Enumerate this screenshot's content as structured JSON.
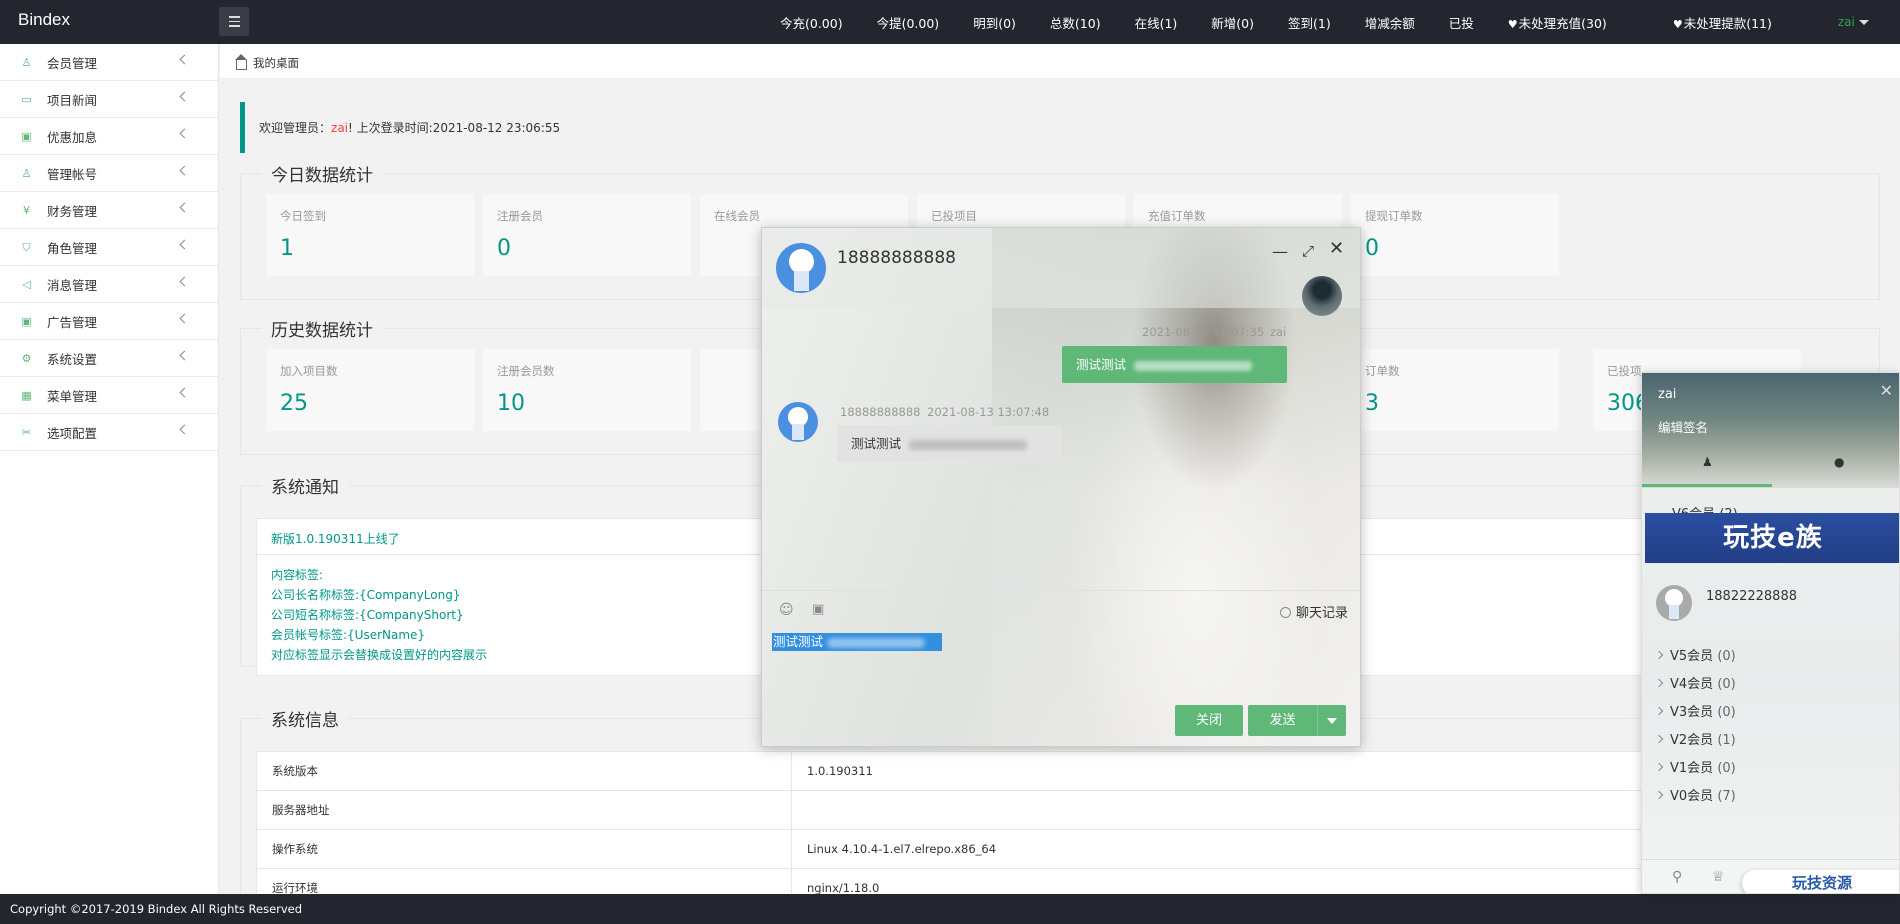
{
  "app": {
    "brand": "Bindex"
  },
  "topnav": {
    "items": [
      "今充(0.00)",
      "今提(0.00)",
      "明到(0)",
      "总数(10)",
      "在线(1)",
      "新增(0)",
      "签到(1)",
      "增减余额",
      "已投"
    ],
    "alerts": [
      "未处理充值(30)",
      "未处理提款(11)"
    ],
    "user": "zai",
    "alert_color": "#ff2b2b"
  },
  "sidebar": {
    "items": [
      {
        "label": "会员管理",
        "icon": "user-icon"
      },
      {
        "label": "项目新闻",
        "icon": "book-icon"
      },
      {
        "label": "优惠加息",
        "icon": "image-icon"
      },
      {
        "label": "管理帐号",
        "icon": "admin-icon"
      },
      {
        "label": "财务管理",
        "icon": "finance-icon"
      },
      {
        "label": "角色管理",
        "icon": "shield-icon"
      },
      {
        "label": "消息管理",
        "icon": "speaker-icon"
      },
      {
        "label": "广告管理",
        "icon": "picture-icon"
      },
      {
        "label": "系统设置",
        "icon": "gear-icon"
      },
      {
        "label": "菜单管理",
        "icon": "grid-icon"
      },
      {
        "label": "选项配置",
        "icon": "tools-icon"
      }
    ]
  },
  "breadcrumb": {
    "home": "我的桌面"
  },
  "welcome": {
    "prefix": "欢迎管理员：",
    "user": "zai",
    "suffix": "! 上次登录时间:2021-08-12 23:06:55"
  },
  "today": {
    "title": "今日数据统计",
    "cards": [
      {
        "label": "今日签到",
        "value": "1"
      },
      {
        "label": "注册会员",
        "value": "0"
      },
      {
        "label": "在线会员",
        "value": ""
      },
      {
        "label": "已投项目",
        "value": ""
      },
      {
        "label": "充值订单数",
        "value": ""
      },
      {
        "label": "提现订单数",
        "value": "0"
      }
    ]
  },
  "history": {
    "title": "历史数据统计",
    "cards": [
      {
        "label": "加入项目数",
        "value": "25"
      },
      {
        "label": "注册会员数",
        "value": "10"
      },
      {
        "label": "",
        "value": ""
      },
      {
        "label": "",
        "value": ""
      },
      {
        "label": "订单数",
        "value": "3"
      },
      {
        "label": "已投项",
        "value": "306"
      }
    ]
  },
  "notice": {
    "title": "系统通知",
    "headline": "新版1.0.190311上线了",
    "lines": [
      "内容标签:",
      "公司长名称标签:{CompanyLong}",
      "公司短名称标签:{CompanyShort}",
      "会员帐号标签:{UserName}",
      "对应标签显示会替换成设置好的内容展示"
    ]
  },
  "sysinfo": {
    "title": "系统信息",
    "rows": [
      {
        "k": "系统版本",
        "v": "1.0.190311"
      },
      {
        "k": "服务器地址",
        "v": ""
      },
      {
        "k": "操作系统",
        "v": "Linux 4.10.4-1.el7.elrepo.x86_64"
      },
      {
        "k": "运行环境",
        "v": "nginx/1.18.0"
      }
    ]
  },
  "footer": {
    "text": "Copyright ©2017-2019 Bindex All Rights Reserved"
  },
  "chat": {
    "title": "18888888888",
    "messages": [
      {
        "who": "me",
        "time": "2021-08-13 13:07:35",
        "name": "zai",
        "text": "测试测试"
      },
      {
        "who": "other",
        "time": "2021-08-13 13:07:48",
        "name": "18888888888",
        "text": "测试测试"
      }
    ],
    "history_label": "聊天记录",
    "input_text": "测试测试",
    "close_label": "关闭",
    "send_label": "发送"
  },
  "panel": {
    "name": "zai",
    "sign": "编辑签名",
    "group_v6": "V6会员",
    "group_v6_count": "(2)",
    "banner": "玩技e族",
    "contact": "18822228888",
    "groups": [
      {
        "name": "V5会员",
        "count": "(0)"
      },
      {
        "name": "V4会员",
        "count": "(0)"
      },
      {
        "name": "V3会员",
        "count": "(0)"
      },
      {
        "name": "V2会员",
        "count": "(1)"
      },
      {
        "name": "V1会员",
        "count": "(0)"
      },
      {
        "name": "V0会员",
        "count": "(7)"
      }
    ],
    "watermark": "玩技资源"
  },
  "colors": {
    "accent": "#009688",
    "green": "#5fb878",
    "topbar": "#23262e"
  }
}
